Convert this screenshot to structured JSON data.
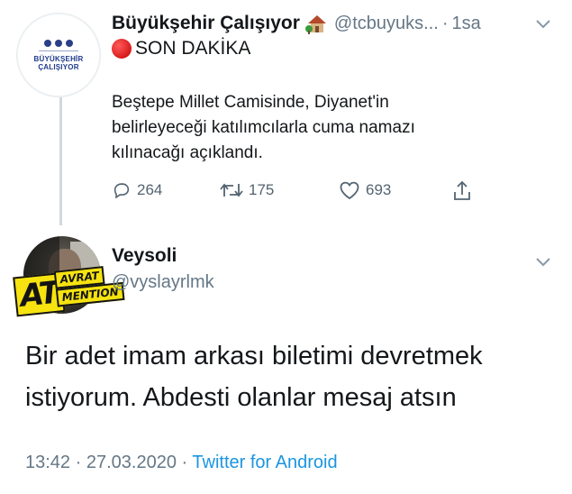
{
  "parent_tweet": {
    "author_name": "Büyükşehir Çalışıyor",
    "author_emoji": "house-with-garden-emoji",
    "handle": "@tcbuyuks...",
    "separator": "·",
    "time_ago": "1sa",
    "avatar_text_line1": "BÜYÜKŞEHİR",
    "avatar_text_line2": "ÇALIŞIYOR",
    "breaking_label": "SON DAKİKA",
    "body_lines": [
      "Beştepe Millet Camisinde, Diyanet'in",
      "belirleyeceği katılımcılarla cuma namazı",
      "kılınacağı açıklandı."
    ],
    "actions": {
      "reply_count": "264",
      "retweet_count": "175",
      "like_count": "693"
    }
  },
  "reply_tweet": {
    "author_name": "Veysoli",
    "handle": "@vyslayrlmk",
    "avatar_badge": {
      "big": "AT",
      "top": "AVRAT",
      "bottom": "MENTION"
    },
    "body_lines": [
      "Bir adet imam arkası biletimi devretmek",
      "istiyorum.  Abdesti olanlar mesaj atsın"
    ],
    "time": "13:42",
    "dot1": "·",
    "date": "27.03.2020",
    "dot2": "·",
    "source": "Twitter for Android"
  },
  "colors": {
    "text": "#14171a",
    "secondary": "#657786",
    "link": "#1b95e0",
    "thread_line": "#cfd9de",
    "badge_yellow": "#f6e30f"
  }
}
